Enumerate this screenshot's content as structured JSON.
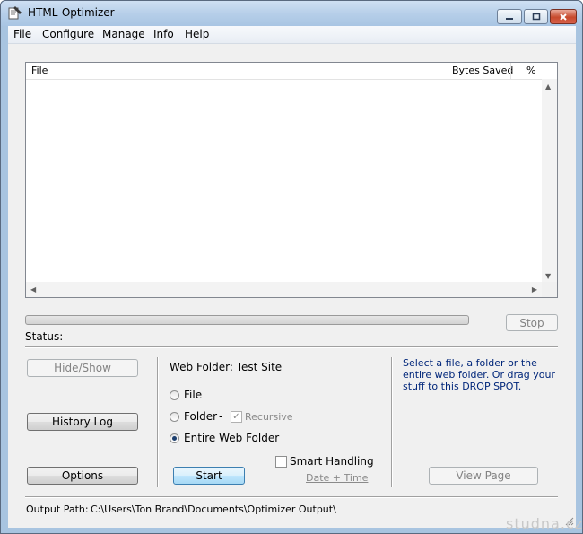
{
  "window": {
    "title": "HTML-Optimizer"
  },
  "menu": [
    "File",
    "Configure",
    "Manage",
    "Info",
    "Help"
  ],
  "list": {
    "columns": [
      "File",
      "Bytes Saved",
      "%"
    ],
    "rows": []
  },
  "progress": {
    "value": 0
  },
  "buttons": {
    "stop": "Stop",
    "hide_show": "Hide/Show",
    "history_log": "History Log",
    "options": "Options",
    "start": "Start",
    "view_page": "View Page"
  },
  "status": {
    "label": "Status:",
    "value": ""
  },
  "web_folder": {
    "label": "Web Folder: Test Site"
  },
  "radios": [
    {
      "label": "File",
      "selected": false
    },
    {
      "label": "Folder",
      "selected": false
    },
    {
      "label": "Entire Web Folder",
      "selected": true
    }
  ],
  "folder_dash": "-",
  "recursive": {
    "label": "Recursive",
    "checked": true,
    "enabled": false
  },
  "smart_handling": {
    "label": "Smart Handling",
    "checked": false
  },
  "date_time_link": "Date + Time",
  "info_text": "Select a file, a folder or the entire web folder. Or drag your stuff to this DROP SPOT.",
  "output": {
    "label": "Output Path:",
    "path": "C:\\Users\\Ton Brand\\Documents\\Optimizer Output\\"
  },
  "watermark": "studna.cz",
  "colors": {
    "info_text": "#00267a",
    "titlebar": "#b7cfe9"
  },
  "icons": [
    "app-icon",
    "minimize-icon",
    "maximize-icon",
    "close-icon",
    "scroll-up-arrow-icon",
    "scroll-down-arrow-icon",
    "scroll-left-arrow-icon",
    "scroll-right-arrow-icon",
    "checkmark-icon",
    "resize-grip-icon"
  ]
}
